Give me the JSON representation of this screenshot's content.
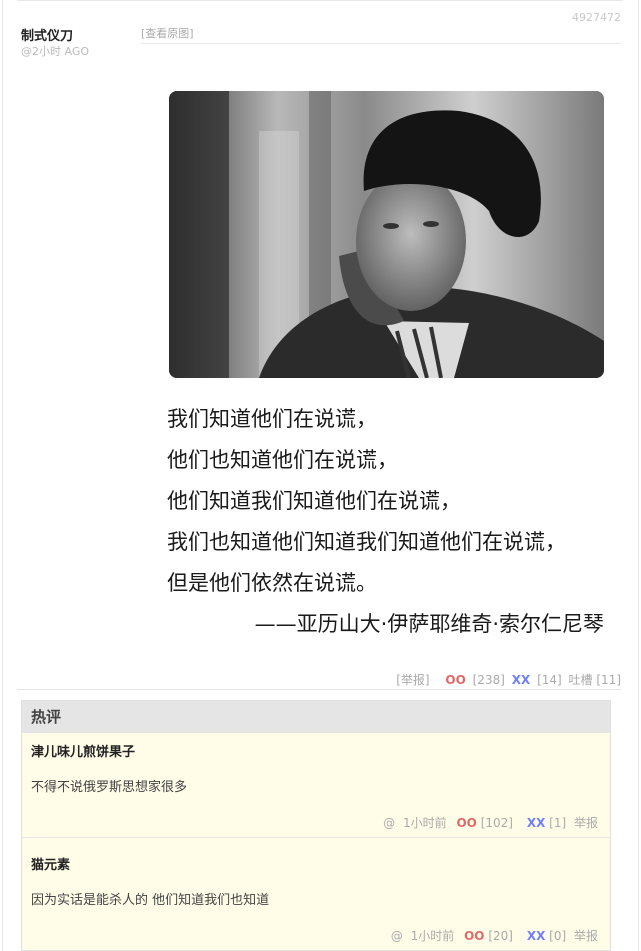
{
  "post": {
    "author": "制式仪刀",
    "time": "@2小时 AGO",
    "id": "4927472",
    "view_original": "[查看原图]",
    "quote_lines": [
      "我们知道他们在说谎，",
      "他们也知道他们在说谎，",
      "他们知道我们知道他们在说谎，",
      "我们也知道他们知道我们知道他们在说谎，",
      "但是他们依然在说谎。"
    ],
    "attribution": "——亚历山大·伊萨耶维奇·索尔仁尼琴",
    "report": "[举报]",
    "oo_label": "OO",
    "oo_count": "[238]",
    "xx_label": "XX",
    "xx_count": "[14]",
    "tucao": "吐槽 [11]"
  },
  "hot": {
    "title": "热评",
    "comments": [
      {
        "author": "津儿味儿煎饼果子",
        "text": "不得不说俄罗斯思想家很多",
        "at": "@",
        "time": "1小时前",
        "oo_label": "OO",
        "oo_count": "[102]",
        "xx_label": "XX",
        "xx_count": "[1]",
        "report": "举报"
      },
      {
        "author": "猫元素",
        "text": "因为实话是能杀人的 他们知道我们也知道",
        "at": "@",
        "time": "1小时前",
        "oo_label": "OO",
        "oo_count": "[20]",
        "xx_label": "XX",
        "xx_count": "[0]",
        "report": "举报"
      }
    ]
  }
}
